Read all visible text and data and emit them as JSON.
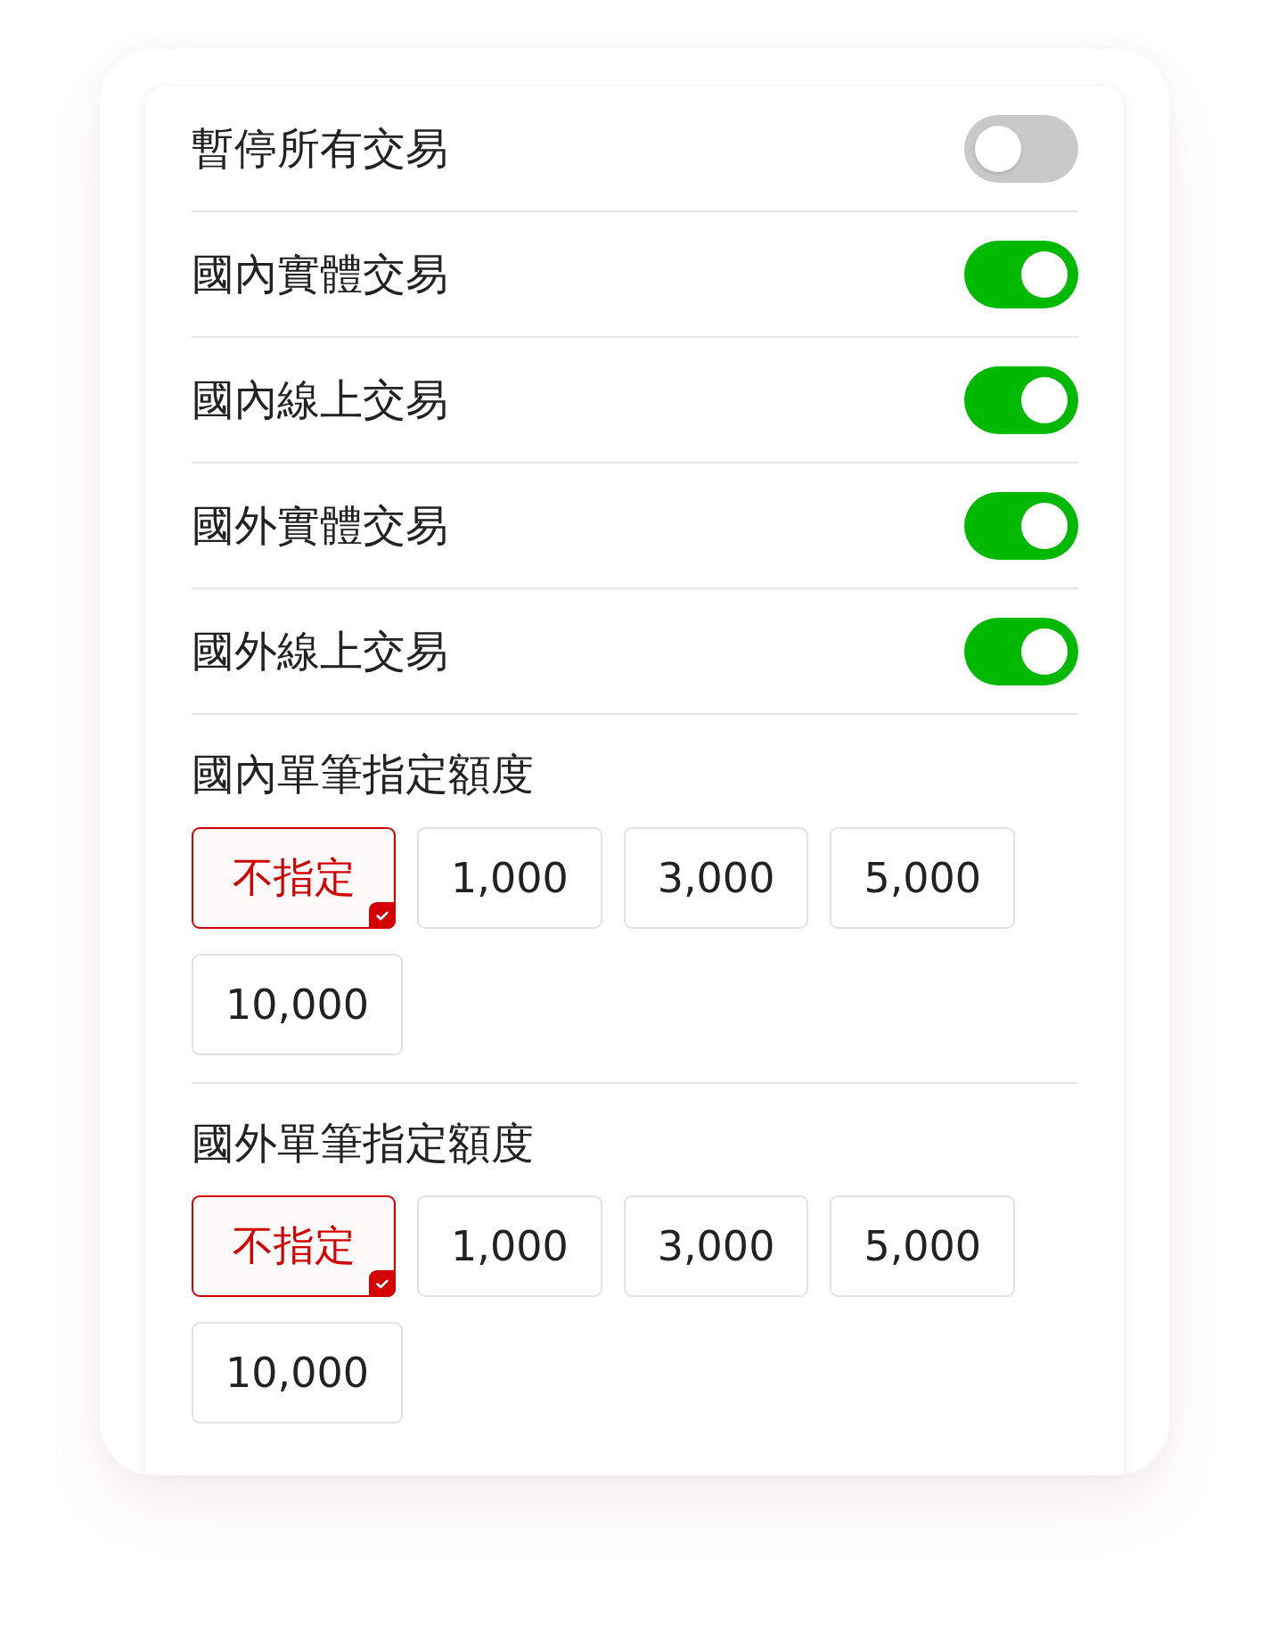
{
  "toggles": [
    {
      "label": "暫停所有交易",
      "on": false
    },
    {
      "label": "國內實體交易",
      "on": true
    },
    {
      "label": "國內線上交易",
      "on": true
    },
    {
      "label": "國外實體交易",
      "on": true
    },
    {
      "label": "國外線上交易",
      "on": true
    }
  ],
  "limit_groups": [
    {
      "title": "國內單筆指定額度",
      "options": [
        {
          "label": "不指定",
          "selected": true
        },
        {
          "label": "1,000",
          "selected": false
        },
        {
          "label": "3,000",
          "selected": false
        },
        {
          "label": "5,000",
          "selected": false
        },
        {
          "label": "10,000",
          "selected": false
        }
      ]
    },
    {
      "title": "國外單筆指定額度",
      "options": [
        {
          "label": "不指定",
          "selected": true
        },
        {
          "label": "1,000",
          "selected": false
        },
        {
          "label": "3,000",
          "selected": false
        },
        {
          "label": "5,000",
          "selected": false
        },
        {
          "label": "10,000",
          "selected": false
        }
      ]
    }
  ]
}
